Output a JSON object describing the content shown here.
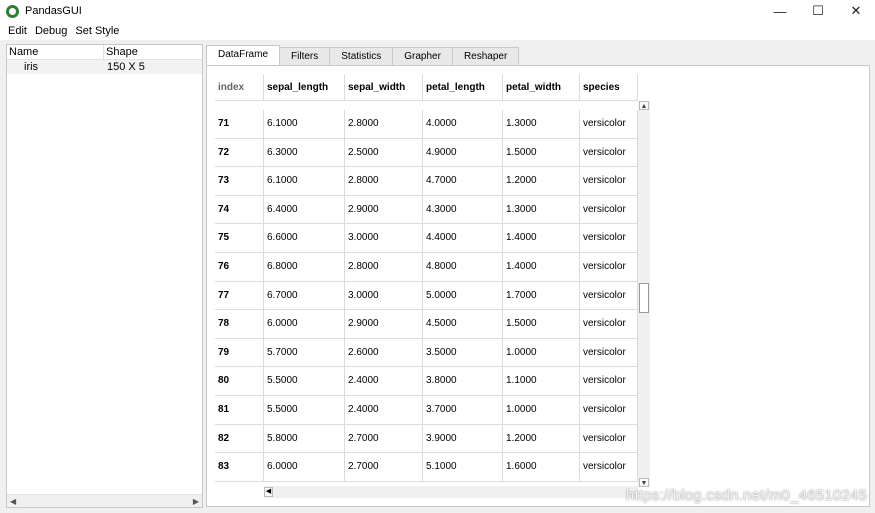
{
  "window": {
    "title": "PandasGUI",
    "minimize": "—",
    "maximize": "☐",
    "close": "✕"
  },
  "menu": [
    "Edit",
    "Debug",
    "Set Style"
  ],
  "left_panel": {
    "headers": {
      "name": "Name",
      "shape": "Shape"
    },
    "rows": [
      {
        "name": "iris",
        "shape": "150 X 5"
      }
    ],
    "scroll_left": "◀",
    "scroll_right": "▶"
  },
  "tabs": [
    "DataFrame",
    "Filters",
    "Statistics",
    "Grapher",
    "Reshaper"
  ],
  "table": {
    "headers": [
      "index",
      "sepal_length",
      "sepal_width",
      "petal_length",
      "petal_width",
      "species"
    ],
    "rows": [
      [
        "71",
        "6.1000",
        "2.8000",
        "4.0000",
        "1.3000",
        "versicolor"
      ],
      [
        "72",
        "6.3000",
        "2.5000",
        "4.9000",
        "1.5000",
        "versicolor"
      ],
      [
        "73",
        "6.1000",
        "2.8000",
        "4.7000",
        "1.2000",
        "versicolor"
      ],
      [
        "74",
        "6.4000",
        "2.9000",
        "4.3000",
        "1.3000",
        "versicolor"
      ],
      [
        "75",
        "6.6000",
        "3.0000",
        "4.4000",
        "1.4000",
        "versicolor"
      ],
      [
        "76",
        "6.8000",
        "2.8000",
        "4.8000",
        "1.4000",
        "versicolor"
      ],
      [
        "77",
        "6.7000",
        "3.0000",
        "5.0000",
        "1.7000",
        "versicolor"
      ],
      [
        "78",
        "6.0000",
        "2.9000",
        "4.5000",
        "1.5000",
        "versicolor"
      ],
      [
        "79",
        "5.7000",
        "2.6000",
        "3.5000",
        "1.0000",
        "versicolor"
      ],
      [
        "80",
        "5.5000",
        "2.4000",
        "3.8000",
        "1.1000",
        "versicolor"
      ],
      [
        "81",
        "5.5000",
        "2.4000",
        "3.7000",
        "1.0000",
        "versicolor"
      ],
      [
        "82",
        "5.8000",
        "2.7000",
        "3.9000",
        "1.2000",
        "versicolor"
      ],
      [
        "83",
        "6.0000",
        "2.7000",
        "5.1000",
        "1.6000",
        "versicolor"
      ]
    ],
    "scroll_up": "▲",
    "scroll_down": "▼",
    "scroll_left": "◀"
  },
  "watermark": "https://blog.csdn.net/m0_46510245"
}
